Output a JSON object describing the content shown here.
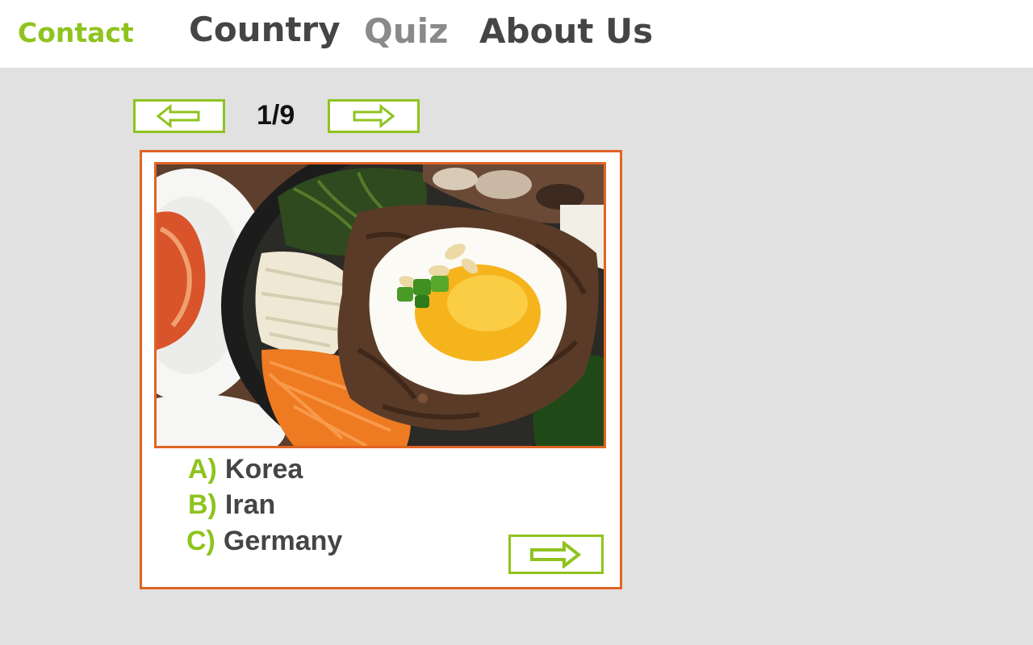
{
  "nav": {
    "contact": "Contact",
    "country": "Country",
    "quiz": "Quiz",
    "about": "About Us"
  },
  "pager": {
    "counter": "1/9",
    "prev_icon": "left-arrow-icon",
    "next_icon": "right-arrow-icon"
  },
  "question": {
    "image_icon": "bibimbap-photo",
    "answers": [
      {
        "letter": "A)",
        "text": "Korea"
      },
      {
        "letter": "B)",
        "text": "Iran"
      },
      {
        "letter": "C)",
        "text": "Germany"
      }
    ],
    "submit_icon": "right-arrow-icon"
  },
  "colors": {
    "accent_green": "#8fc31f",
    "border_orange": "#e06424",
    "text_dark": "#454545",
    "nav_inactive": "#8a8a8a",
    "background": "#e1e1e1"
  }
}
